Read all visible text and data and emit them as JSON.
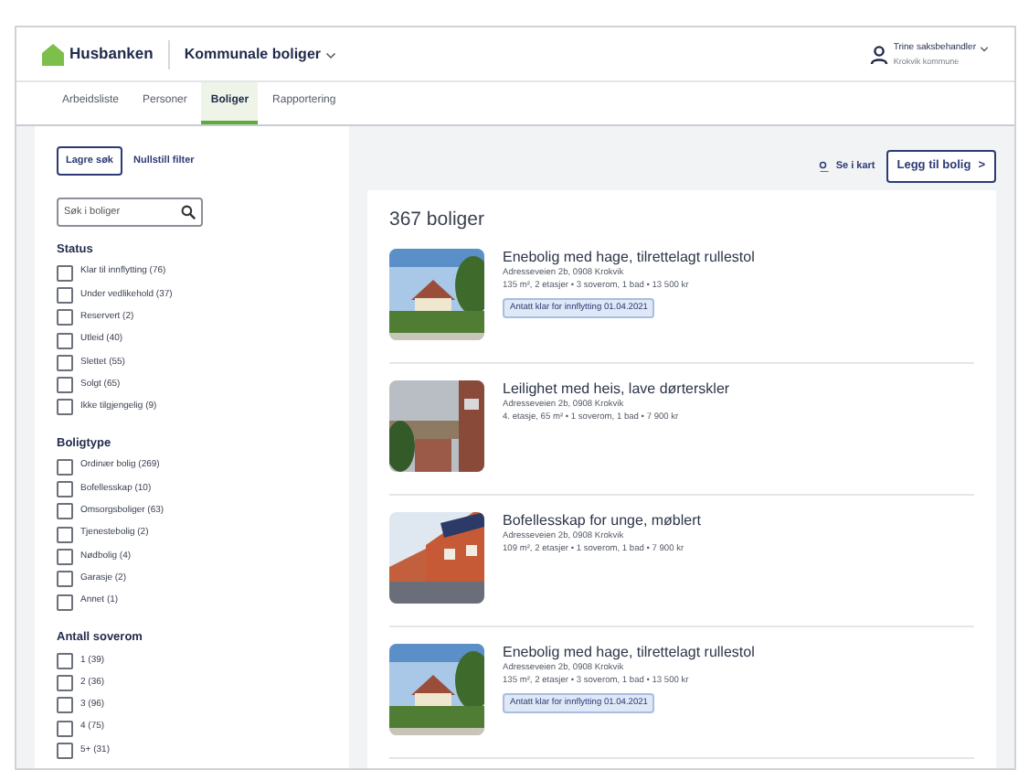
{
  "header": {
    "logo": "Husbanken",
    "module": "Kommunale boliger",
    "user": {
      "name": "Trine saksbehandler",
      "org": "Krokvik kommune"
    }
  },
  "tabs": [
    {
      "label": "Arbeidsliste",
      "selected": false
    },
    {
      "label": "Personer",
      "selected": false
    },
    {
      "label": "Boliger",
      "selected": true
    },
    {
      "label": "Rapportering",
      "selected": false
    }
  ],
  "sidebar": {
    "save_button": "Lagre søk",
    "reset_link": "Nullstill filter",
    "search": {
      "placeholder": "Søk i boliger"
    },
    "groups": [
      {
        "title": "Status",
        "options": [
          {
            "label": "Klar til innflytting (76)",
            "checked": false
          },
          {
            "label": "Under vedlikehold (37)",
            "checked": false
          },
          {
            "label": "Reservert (2)",
            "checked": false
          },
          {
            "label": "Utleid (40)",
            "checked": false
          },
          {
            "label": "Slettet (55)",
            "checked": false
          },
          {
            "label": "Solgt (65)",
            "checked": false
          },
          {
            "label": "Ikke tilgjengelig (9)",
            "checked": false
          }
        ]
      },
      {
        "title": "Boligtype",
        "options": [
          {
            "label": "Ordinær bolig (269)",
            "checked": false
          },
          {
            "label": "Bofellesskap (10)",
            "checked": false
          },
          {
            "label": "Omsorgsboliger (63)",
            "checked": false
          },
          {
            "label": "Tjenestebolig (2)",
            "checked": false
          },
          {
            "label": "Nødbolig (4)",
            "checked": false
          },
          {
            "label": "Garasje (2)",
            "checked": false
          },
          {
            "label": "Annet (1)",
            "checked": false
          }
        ]
      },
      {
        "title": "Antall soverom",
        "options": [
          {
            "label": "1 (39)",
            "checked": false
          },
          {
            "label": "2 (36)",
            "checked": false
          },
          {
            "label": "3 (96)",
            "checked": false
          },
          {
            "label": "4 (75)",
            "checked": false
          },
          {
            "label": "5+ (31)",
            "checked": false
          }
        ]
      }
    ]
  },
  "actions": {
    "map_link": "Se i kart",
    "add_button": "Legg til bolig",
    "add_icon": ">"
  },
  "results": {
    "count": "367 boliger",
    "listings": [
      {
        "title": "Enebolig med hage, tilrettelagt rullestol",
        "address": "Adresseveien 2b, 0908 Krokvik",
        "details": "135 m², 2 etasjer  •  3 soverom, 1 bad  •  13 500 kr",
        "badge": "Antatt klar for innflytting 01.04.2021"
      },
      {
        "title": "Leilighet med heis, lave dørterskler",
        "address": "Adresseveien 2b, 0908 Krokvik",
        "details": "4. etasje, 65 m²  •  1 soverom, 1 bad  •  7 900 kr"
      },
      {
        "title": "Bofellesskap for unge, møblert",
        "address": "Adresseveien 2b, 0908 Krokvik",
        "details": "109 m², 2 etasjer  •  1 soverom, 1 bad  •  7 900 kr"
      },
      {
        "title": "Enebolig med hage, tilrettelagt rullestol",
        "address": "Adresseveien 2b, 0908 Krokvik",
        "details": "135 m², 2 etasjer  •  3 soverom, 1 bad  •  13 500 kr",
        "badge": "Antatt klar for innflytting 01.04.2021"
      }
    ]
  }
}
